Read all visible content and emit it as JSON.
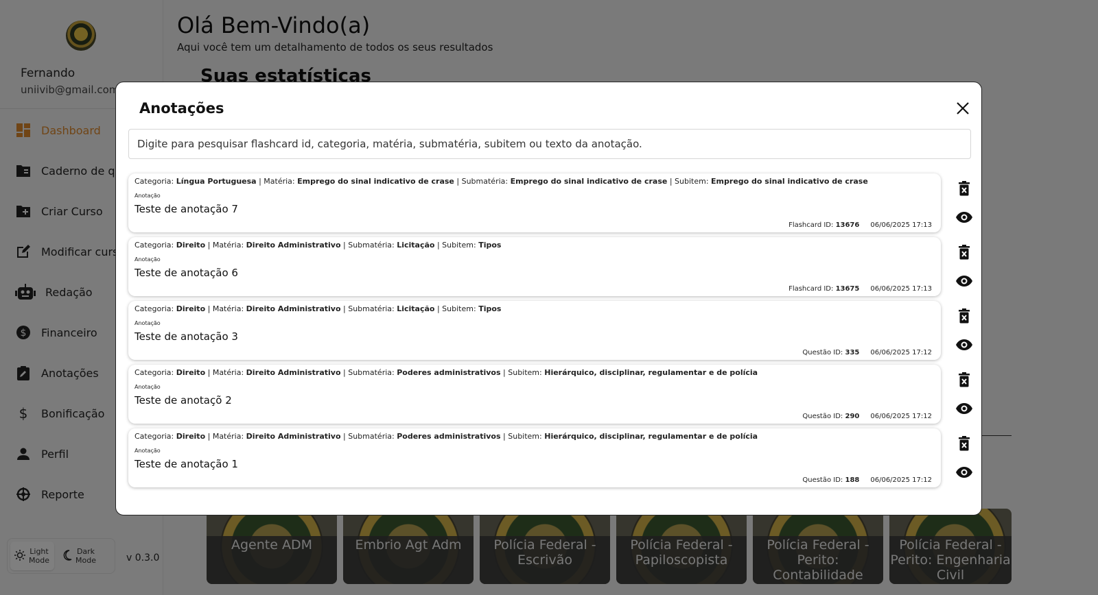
{
  "sidebar": {
    "user_name": "Fernando",
    "user_email": "uniivib@gmail.com",
    "items": [
      {
        "label": "Dashboard",
        "icon": "dashboard-icon"
      },
      {
        "label": "Caderno de  qu",
        "icon": "folder-icon"
      },
      {
        "label": "Criar Curso",
        "icon": "folder-add-icon"
      },
      {
        "label": "Modificar curso",
        "icon": "edit-icon"
      },
      {
        "label": "Redação",
        "icon": "robot-icon"
      },
      {
        "label": "Financeiro",
        "icon": "dollar-circle-icon"
      },
      {
        "label": "Anotações",
        "icon": "clipboard-edit-icon"
      },
      {
        "label": "Bonificação",
        "icon": "dollar-icon"
      },
      {
        "label": "Perfil",
        "icon": "person-icon"
      },
      {
        "label": "Reporte",
        "icon": "bug-icon"
      }
    ],
    "light_mode_label": "Light Mode",
    "dark_mode_label": "Dark Mode",
    "version": "v 0.3.0"
  },
  "main": {
    "greeting": "Olá Bem-Vindo(a)",
    "greeting_sub": "Aqui você tem um detalhamento de todos os seus resultados",
    "stats_title": "Suas estatísticas",
    "courses": [
      "Agente ADM",
      "Embrio Agt Adm",
      "Polícia Federal - Escrivão",
      "Polícia Federal - Papiloscopista",
      "Polícia Federal - Perito: Contabilidade",
      "Polícia Federal - Perito: Engenharia Civil"
    ]
  },
  "modal": {
    "title": "Anotações",
    "search_placeholder": "Digite para pesquisar flashcard id, categoria, matéria, submatéria, subitem ou texto da anotação.",
    "labels": {
      "categoria": "Categoria:",
      "materia": "| Matéria:",
      "submateria": "| Submatéria:",
      "subitem": "| Subitem:",
      "anotacao": "Anotação"
    },
    "notes": [
      {
        "categoria": "Língua Portuguesa",
        "materia": "Emprego do sinal indicativo de crase",
        "submateria": "Emprego do sinal indicativo de crase",
        "subitem": "Emprego do sinal indicativo de crase",
        "text": "Teste de anotação 7",
        "id_label": "Flashcard ID:",
        "id": "13676",
        "date": "06/06/2025 17:13"
      },
      {
        "categoria": "Direito",
        "materia": "Direito Administrativo",
        "submateria": "Licitação",
        "subitem": "Tipos",
        "text": "Teste de anotação 6",
        "id_label": "Flashcard ID:",
        "id": "13675",
        "date": "06/06/2025 17:13"
      },
      {
        "categoria": "Direito",
        "materia": "Direito Administrativo",
        "submateria": "Licitação",
        "subitem": "Tipos",
        "text": "Teste de anotação 3",
        "id_label": "Questão ID:",
        "id": "335",
        "date": "06/06/2025 17:12"
      },
      {
        "categoria": "Direito",
        "materia": "Direito Administrativo",
        "submateria": "Poderes administrativos",
        "subitem": "Hierárquico, disciplinar, regulamentar e de polícia",
        "text": "Teste de anotaçõ 2",
        "id_label": "Questão ID:",
        "id": "290",
        "date": "06/06/2025 17:12"
      },
      {
        "categoria": "Direito",
        "materia": "Direito Administrativo",
        "submateria": "Poderes administrativos",
        "subitem": "Hierárquico, disciplinar, regulamentar e de polícia",
        "text": "Teste de anotação 1",
        "id_label": "Questão ID:",
        "id": "188",
        "date": "06/06/2025 17:12"
      }
    ]
  },
  "colors": {
    "accent": "#e08a2c",
    "overlay": "rgba(0,0,0,0.5)"
  }
}
